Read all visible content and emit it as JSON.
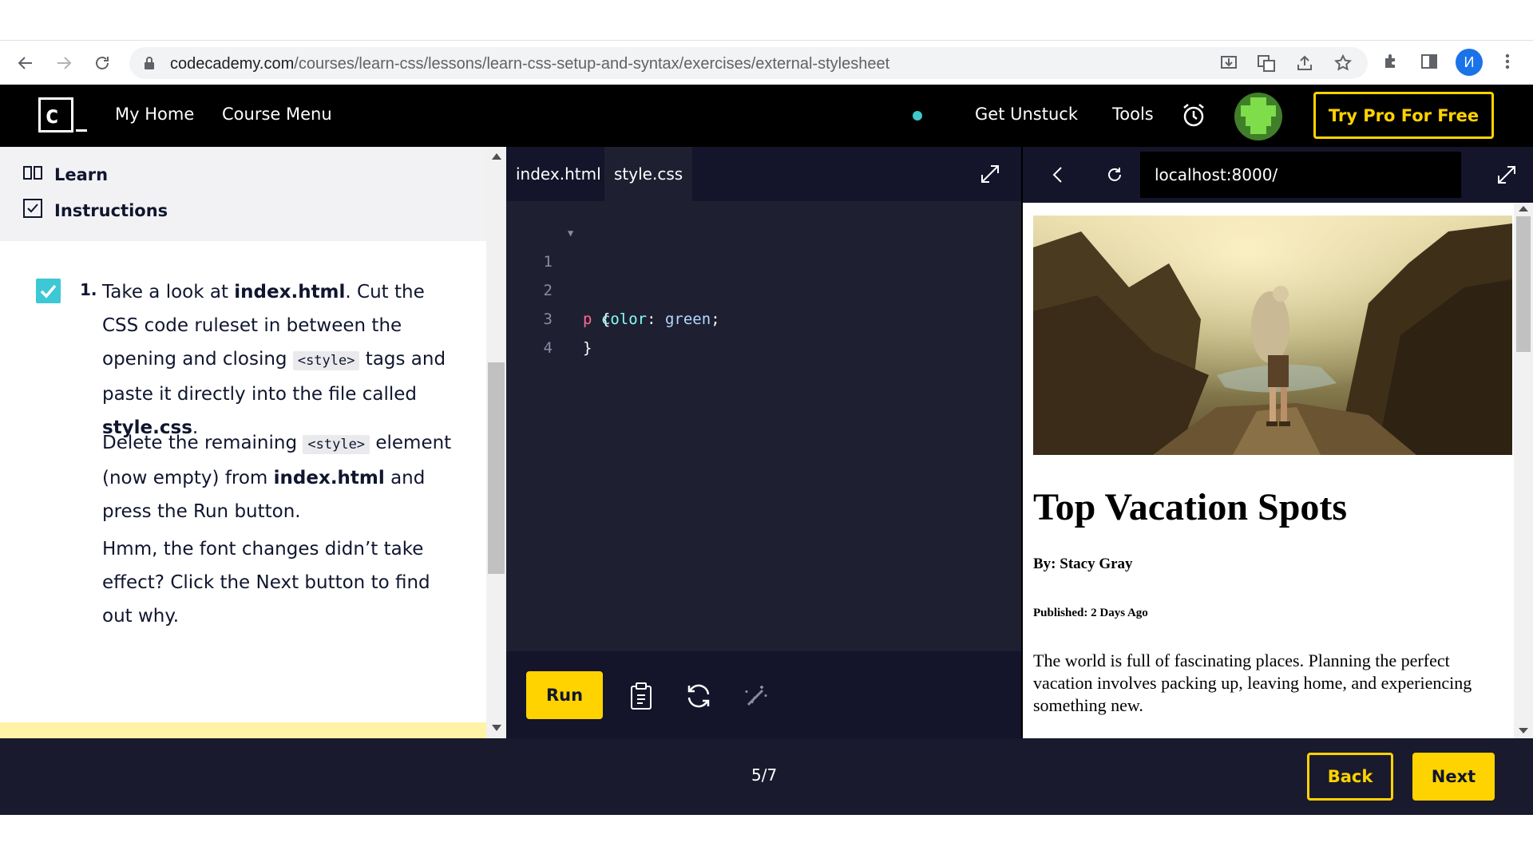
{
  "browser": {
    "url_domain": "codecademy.com",
    "url_path": "/courses/learn-css/lessons/learn-css-setup-and-syntax/exercises/external-stylesheet",
    "profile_initial": "И"
  },
  "header": {
    "my_home": "My Home",
    "course_menu": "Course Menu",
    "get_unstuck": "Get Unstuck",
    "tools": "Tools",
    "try_pro": "Try Pro For Free",
    "status_color": "#3ec8c8",
    "accent": "#ffd300"
  },
  "left_panel": {
    "tab_learn": "Learn",
    "tab_instructions": "Instructions",
    "step_number": "1.",
    "p1_a": "Take a look at ",
    "p1_b": "index.html",
    "p1_c": ". Cut the CSS code ruleset in between the opening and closing ",
    "p1_code": "<style>",
    "p1_d": " tags and paste it directly into the file called ",
    "p1_e": "style.css",
    "p1_f": ".",
    "p2_a": "Delete the remaining ",
    "p2_code": "<style>",
    "p2_b": " element (now empty) from ",
    "p2_c": "index.html",
    "p2_d": " and press the Run button.",
    "p3": "Hmm, the font changes didn’t take effect? Click the Next button to find out why."
  },
  "editor": {
    "tabs": [
      "index.html",
      "style.css"
    ],
    "active_tab": "style.css",
    "lines": [
      {
        "n": "1",
        "sel": "p",
        "rest": " {"
      },
      {
        "n": "2",
        "prop": "color",
        "val": "green"
      },
      {
        "n": "3",
        "text": "}"
      },
      {
        "n": "4",
        "text": ""
      }
    ],
    "run_label": "Run"
  },
  "preview": {
    "url": "localhost:8000/",
    "title": "Top Vacation Spots",
    "byline": "By: Stacy Gray",
    "published": "Published: 2 Days Ago",
    "body": "The world is full of fascinating places. Planning the perfect vacation involves packing up, leaving home, and experiencing something new."
  },
  "footer": {
    "progress": "5/7",
    "back": "Back",
    "next": "Next"
  }
}
